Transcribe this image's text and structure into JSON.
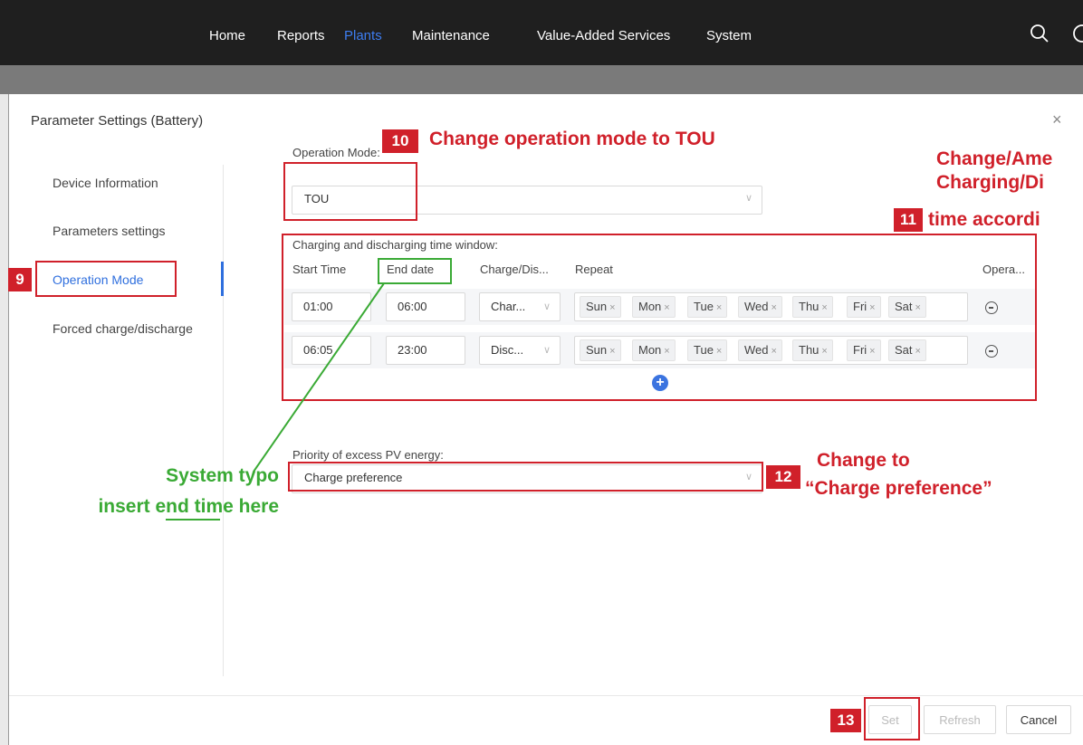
{
  "nav": {
    "items": [
      {
        "label": "Home",
        "active": false
      },
      {
        "label": "Reports",
        "active": false
      },
      {
        "label": "Plants",
        "active": true
      },
      {
        "label": "Maintenance",
        "active": false
      },
      {
        "label": "Value-Added Services",
        "active": false
      },
      {
        "label": "System",
        "active": false
      }
    ]
  },
  "dialog": {
    "title": "Parameter Settings (Battery)",
    "close": "×"
  },
  "sidebar": {
    "items": [
      {
        "label": "Device Information"
      },
      {
        "label": "Parameters settings"
      },
      {
        "label": "Operation Mode",
        "active": true
      },
      {
        "label": "Forced charge/discharge"
      }
    ]
  },
  "form": {
    "operation_mode_label": "Operation Mode:",
    "operation_mode_value": "TOU",
    "time_window_label": "Charging and discharging time window:",
    "columns": [
      "Start Time",
      "End date",
      "Charge/Dis...",
      "Repeat",
      "Opera..."
    ],
    "rows": [
      {
        "start": "01:00",
        "end": "06:00",
        "mode": "Char...",
        "days": [
          "Sun",
          "Mon",
          "Tue",
          "Wed",
          "Thu",
          "Fri",
          "Sat"
        ]
      },
      {
        "start": "06:05",
        "end": "23:00",
        "mode": "Disc...",
        "days": [
          "Sun",
          "Mon",
          "Tue",
          "Wed",
          "Thu",
          "Fri",
          "Sat"
        ]
      }
    ],
    "tag_close": "×",
    "pv_label": "Priority of excess PV energy:",
    "pv_value": "Charge preference"
  },
  "buttons": {
    "set": "Set",
    "refresh": "Refresh",
    "cancel": "Cancel"
  },
  "annotations": {
    "step9": "9",
    "step10": "10",
    "step10_text": "Change operation mode to TOU",
    "step11": "11",
    "step11_lines": [
      "Change/Ame",
      "Charging/Di",
      "time accordi"
    ],
    "step12": "12",
    "step12_lines": [
      "Change to",
      "“Charge preference”"
    ],
    "step13": "13",
    "typo_lines": [
      "System typo",
      "insert end time here"
    ]
  },
  "colors": {
    "accent": "#2f6fde",
    "annotation_red": "#d0202a",
    "annotation_green": "#3aaa35",
    "topbar": "#1f1f1f"
  }
}
